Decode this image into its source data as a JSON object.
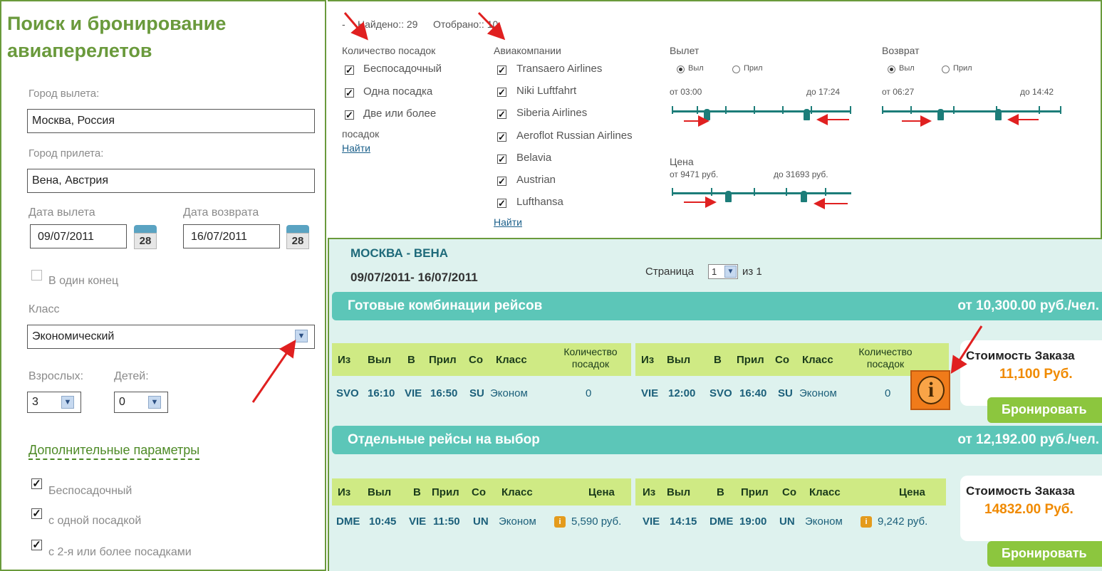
{
  "search_panel": {
    "title": "Поиск и бронирование авиаперелетов",
    "departure_city_label": "Город вылета:",
    "departure_city_value": "Москва,  Россия",
    "arrival_city_label": "Город прилета:",
    "arrival_city_value": "Вена,  Австрия",
    "departure_date_label": "Дата вылета",
    "departure_date_value": "09/07/2011",
    "return_date_label": "Дата возврата",
    "return_date_value": "16/07/2011",
    "calendar_day": "28",
    "one_way_label": "В один конец",
    "class_label": "Класс",
    "class_value": "Экономический",
    "adults_label": "Взрослых:",
    "adults_value": "3",
    "children_label": "Детей:",
    "children_value": "0",
    "advanced_label": "Дополнительные параметры",
    "advanced_options": [
      "Беспосадочный",
      "с одной посадкой",
      "с 2-я или более посадками"
    ]
  },
  "filters": {
    "found_label": "Найдено:: 29",
    "filtered_label": "Отобрано:: 10",
    "stops_title": "Количество посадок",
    "stops": [
      "Беспосадочный",
      "Одна посадка",
      "Две или более"
    ],
    "stops_extra": "посадок",
    "find_link": "Найти",
    "airlines_title": "Авиакомпании",
    "airlines": [
      "Transaero Airlines",
      "Niki Luftfahrt",
      "Siberia Airlines",
      "Aeroflot Russian Airlines",
      "Belavia",
      "Austrian",
      "Lufthansa"
    ],
    "departure": {
      "title": "Вылет",
      "radio_dep": "Выл",
      "radio_arr": "Прил",
      "from": "от  03:00",
      "to": "до  17:24"
    },
    "return": {
      "title": "Возврат",
      "radio_dep": "Выл",
      "radio_arr": "Прил",
      "from": "от  06:27",
      "to": "до  14:42"
    },
    "price": {
      "title": "Цена",
      "from": "от  9471  руб.",
      "to": "до  31693  руб."
    }
  },
  "results": {
    "route": "МОСКВА - ВЕНА",
    "dates": "09/07/2011- 16/07/2011",
    "page_label": "Страница",
    "page_value": "1",
    "page_of": "из 1",
    "combos": {
      "title": "Готовые комбинации рейсов",
      "price_from": "от  10,300.00 руб./чел.",
      "headers": [
        "Из",
        "Выл",
        "В",
        "Прил",
        "Со",
        "Класс",
        "Количество посадок"
      ],
      "outbound": [
        "SVO",
        "16:10",
        "VIE",
        "16:50",
        "SU",
        "Эконом",
        "0"
      ],
      "inbound": [
        "VIE",
        "12:00",
        "SVO",
        "16:40",
        "SU",
        "Эконом",
        "0"
      ],
      "order_title": "Стоимость Заказа",
      "order_price": "11,100 Руб.",
      "book": "Бронировать"
    },
    "separate": {
      "title": "Отдельные рейсы на выбор",
      "price_from": "от  12,192.00 руб./чел.",
      "headers": [
        "Из",
        "Выл",
        "В",
        "Прил",
        "Со",
        "Класс",
        "Цена"
      ],
      "outbound": [
        "DME",
        "10:45",
        "VIE",
        "11:50",
        "UN",
        "Эконом",
        "5,590 руб."
      ],
      "inbound": [
        "VIE",
        "14:15",
        "DME",
        "19:00",
        "UN",
        "Эконом",
        "9,242 руб."
      ],
      "order_title": "Стоимость Заказа",
      "order_price": "14832.00 Руб.",
      "book": "Бронировать"
    }
  },
  "colors": {
    "panel_border": "#6a9a3c",
    "band": "#5cc6b8",
    "table_header": "#cfea84",
    "book_button": "#8cc63e",
    "price_orange": "#f08a00",
    "annotation_arrow": "#e02020"
  },
  "icons": [
    "calendar-icon",
    "dropdown-arrow-icon",
    "info-icon",
    "annotation-arrow-icon"
  ]
}
